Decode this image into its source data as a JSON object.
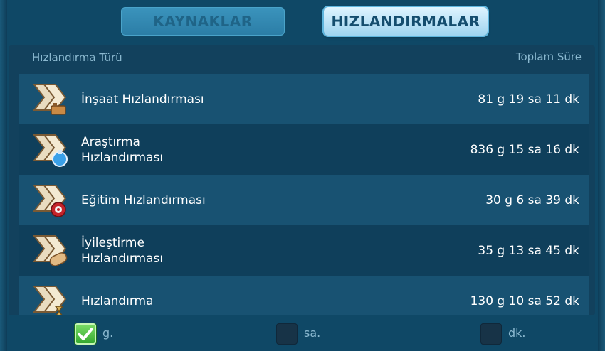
{
  "tabs": [
    {
      "label": "KAYNAKLAR",
      "active": false
    },
    {
      "label": "HIZLANDIRMALAR",
      "active": true
    }
  ],
  "table": {
    "header_left": "Hızlandırma Türü",
    "header_right": "Toplam Süre",
    "rows": [
      {
        "label": "İnşaat Hızlandırması",
        "time": "81 g 19 sa 11 dk",
        "icon": "construction-speedup-icon"
      },
      {
        "label": "Araştırma\nHızlandırması",
        "time": "836 g 15 sa 16 dk",
        "icon": "research-speedup-icon"
      },
      {
        "label": "Eğitim Hızlandırması",
        "time": "30 g 6 sa 39 dk",
        "icon": "training-speedup-icon"
      },
      {
        "label": "İyileştirme\nHızlandırması",
        "time": "35 g 13 sa 45 dk",
        "icon": "healing-speedup-icon"
      },
      {
        "label": "Hızlandırma",
        "time": "130 g 10 sa 52 dk",
        "icon": "universal-speedup-icon"
      }
    ]
  },
  "footer": {
    "days_label": "g.",
    "hours_label": "sa.",
    "minutes_label": "dk.",
    "days_checked": true,
    "hours_checked": false,
    "minutes_checked": false
  },
  "colors": {
    "accent_green": "#2fa52b",
    "text_muted": "#8ab8cf",
    "panel_bg": "#12415d"
  }
}
